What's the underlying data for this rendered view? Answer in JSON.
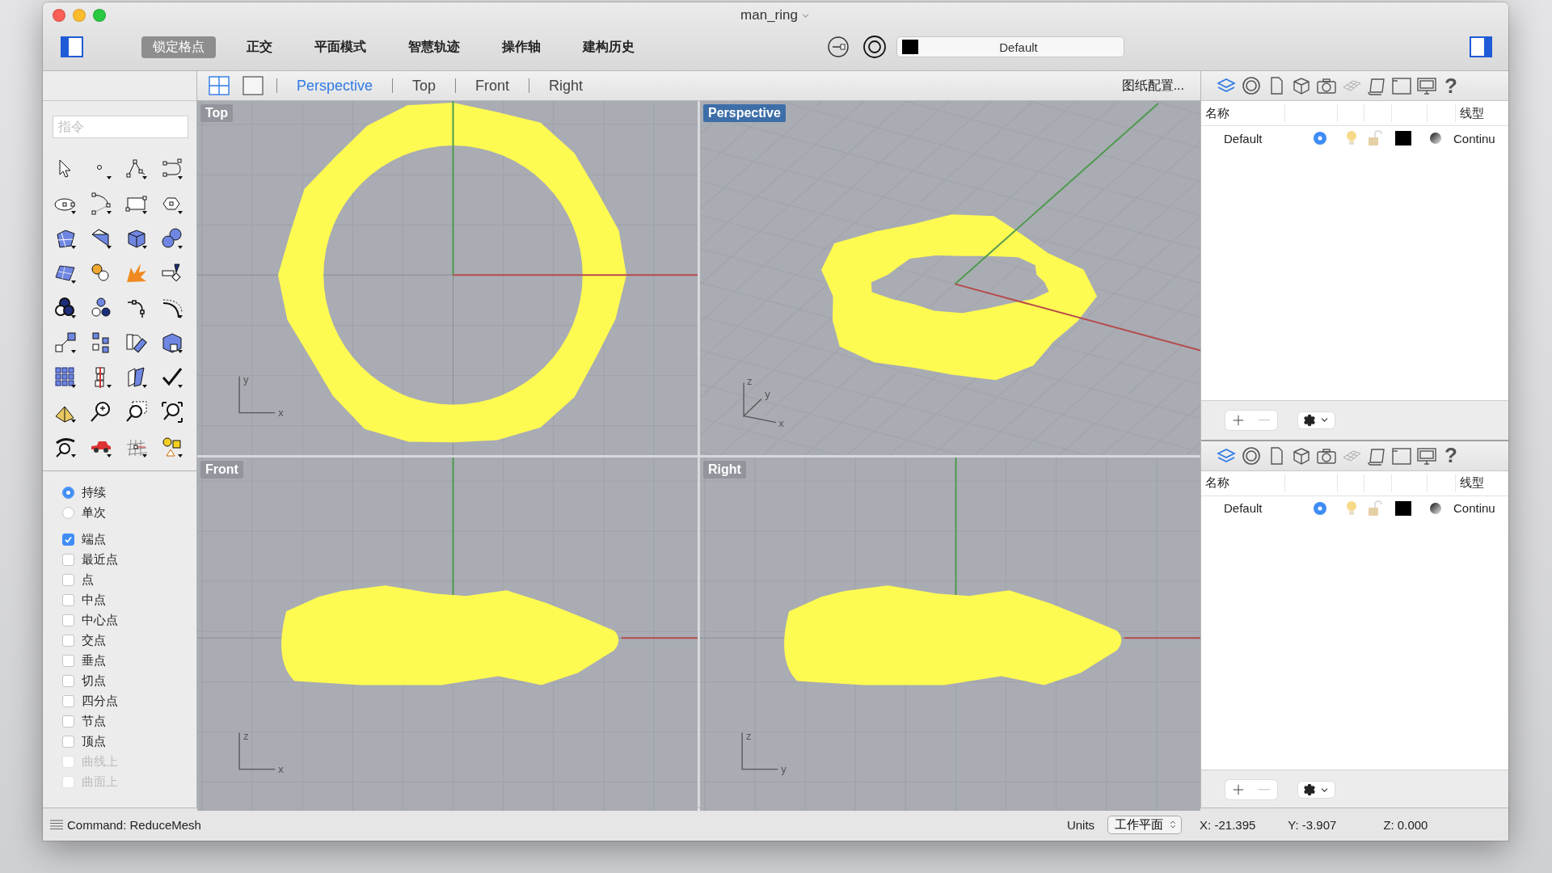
{
  "window": {
    "title": "man_ring"
  },
  "toolbar": {
    "toggles": [
      {
        "label": "锁定格点",
        "on": true
      },
      {
        "label": "正交",
        "on": false
      },
      {
        "label": "平面模式",
        "on": false
      },
      {
        "label": "智慧轨迹",
        "on": false
      },
      {
        "label": "操作轴",
        "on": false
      },
      {
        "label": "建构历史",
        "on": false
      }
    ],
    "layer": {
      "value": "Default",
      "color": "#000000"
    }
  },
  "viewport_bar": {
    "layouts": [
      {
        "selected": true
      },
      {
        "selected": false
      }
    ],
    "tabs": [
      {
        "label": "Perspective",
        "selected": true
      },
      {
        "label": "Top",
        "selected": false
      },
      {
        "label": "Front",
        "selected": false
      },
      {
        "label": "Right",
        "selected": false
      }
    ],
    "layout_menu": "图纸配置..."
  },
  "viewports": [
    {
      "kind": "top",
      "title": "Top",
      "selected": false,
      "axes": [
        "y",
        "x"
      ]
    },
    {
      "kind": "perspective",
      "title": "Perspective",
      "selected": true,
      "axes": [
        "z",
        "y",
        "x"
      ]
    },
    {
      "kind": "front",
      "title": "Front",
      "selected": false,
      "axes": [
        "z",
        "x"
      ]
    },
    {
      "kind": "right",
      "title": "Right",
      "selected": false,
      "axes": [
        "z",
        "y"
      ]
    }
  ],
  "sidebar": {
    "command_placeholder": "指令",
    "repeat": [
      {
        "label": "持续",
        "selected": true
      },
      {
        "label": "单次",
        "selected": false
      }
    ],
    "osnaps": [
      {
        "label": "端点",
        "checked": true,
        "disabled": false
      },
      {
        "label": "最近点",
        "checked": false,
        "disabled": false
      },
      {
        "label": "点",
        "checked": false,
        "disabled": false
      },
      {
        "label": "中点",
        "checked": false,
        "disabled": false
      },
      {
        "label": "中心点",
        "checked": false,
        "disabled": false
      },
      {
        "label": "交点",
        "checked": false,
        "disabled": false
      },
      {
        "label": "垂点",
        "checked": false,
        "disabled": false
      },
      {
        "label": "切点",
        "checked": false,
        "disabled": false
      },
      {
        "label": "四分点",
        "checked": false,
        "disabled": false
      },
      {
        "label": "节点",
        "checked": false,
        "disabled": false
      },
      {
        "label": "顶点",
        "checked": false,
        "disabled": false
      },
      {
        "label": "曲线上",
        "checked": false,
        "disabled": true
      },
      {
        "label": "曲面上",
        "checked": false,
        "disabled": true
      }
    ]
  },
  "layer_panels": [
    {
      "tabs": [
        {
          "selected": true
        },
        {
          "selected": false
        },
        {
          "selected": false
        },
        {
          "selected": false
        },
        {
          "selected": false
        },
        {
          "selected": false
        },
        {
          "selected": false
        },
        {
          "selected": false
        },
        {
          "selected": false
        }
      ],
      "help": "?",
      "columns": [
        "名称",
        "线型"
      ],
      "rows": [
        {
          "name": "Default",
          "current": true,
          "color": "#000000",
          "linetype": "Continu"
        }
      ]
    },
    {
      "tabs": [
        {
          "selected": true
        },
        {
          "selected": false
        },
        {
          "selected": false
        },
        {
          "selected": false
        },
        {
          "selected": false
        },
        {
          "selected": false
        },
        {
          "selected": false
        },
        {
          "selected": false
        },
        {
          "selected": false
        }
      ],
      "help": "?",
      "columns": [
        "名称",
        "线型"
      ],
      "rows": [
        {
          "name": "Default",
          "current": true,
          "color": "#000000",
          "linetype": "Continu"
        }
      ]
    }
  ],
  "status_bar": {
    "command": "Command: ReduceMesh",
    "units": "Units",
    "cplane": "工作平面",
    "x": "X: -21.395",
    "y": "Y: -3.907",
    "z": "Z: 0.000"
  }
}
